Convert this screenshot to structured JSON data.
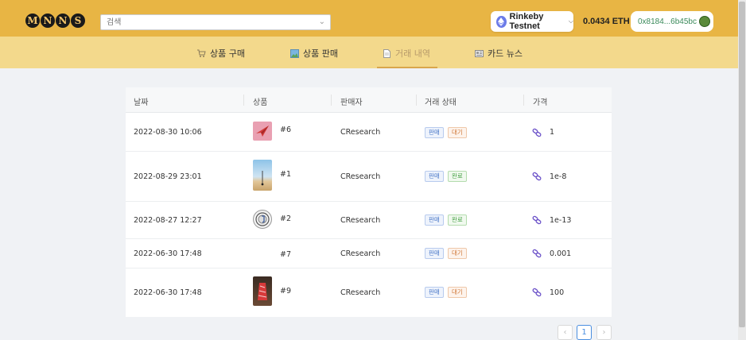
{
  "header": {
    "logo_letters": [
      "M",
      "N",
      "N",
      "S"
    ],
    "search_placeholder": "검색",
    "network_label": "Rinkeby Testnet",
    "balance": "0.0434 ETH",
    "wallet_address": "0x8184...6b45bc"
  },
  "nav": [
    {
      "label": "상품 구매",
      "icon": "cart-icon",
      "active": false
    },
    {
      "label": "상품 판매",
      "icon": "picture-icon",
      "active": false
    },
    {
      "label": "거래 내역",
      "icon": "document-icon",
      "active": true
    },
    {
      "label": "카드 뉴스",
      "icon": "newspaper-icon",
      "active": false
    }
  ],
  "table": {
    "columns": [
      "날짜",
      "상품",
      "판매자",
      "거래 상태",
      "가격"
    ],
    "rows": [
      {
        "date": "2022-08-30 10:06",
        "item": "#6",
        "seller": "CResearch",
        "type": "판매",
        "status": "대기",
        "status_kind": "wait",
        "price": "1",
        "thumb": "paper-plane"
      },
      {
        "date": "2022-08-29 23:01",
        "item": "#1",
        "seller": "CResearch",
        "type": "판매",
        "status": "완료",
        "status_kind": "done",
        "price": "1e-8",
        "thumb": "beach"
      },
      {
        "date": "2022-08-27 12:27",
        "item": "#2",
        "seller": "CResearch",
        "type": "판매",
        "status": "완료",
        "status_kind": "done",
        "price": "1e-13",
        "thumb": "seal"
      },
      {
        "date": "2022-06-30 17:48",
        "item": "#7",
        "seller": "CResearch",
        "type": "판매",
        "status": "대기",
        "status_kind": "wait",
        "price": "0.001",
        "thumb": "none"
      },
      {
        "date": "2022-06-30 17:48",
        "item": "#9",
        "seller": "CResearch",
        "type": "판매",
        "status": "대기",
        "status_kind": "wait",
        "price": "100",
        "thumb": "red-tower"
      }
    ]
  },
  "pagination": {
    "prev": "‹",
    "current": "1",
    "next": "›"
  },
  "colors": {
    "header": "#e8b544",
    "nav": "#f3d98c",
    "accent": "#4a8ee0"
  }
}
